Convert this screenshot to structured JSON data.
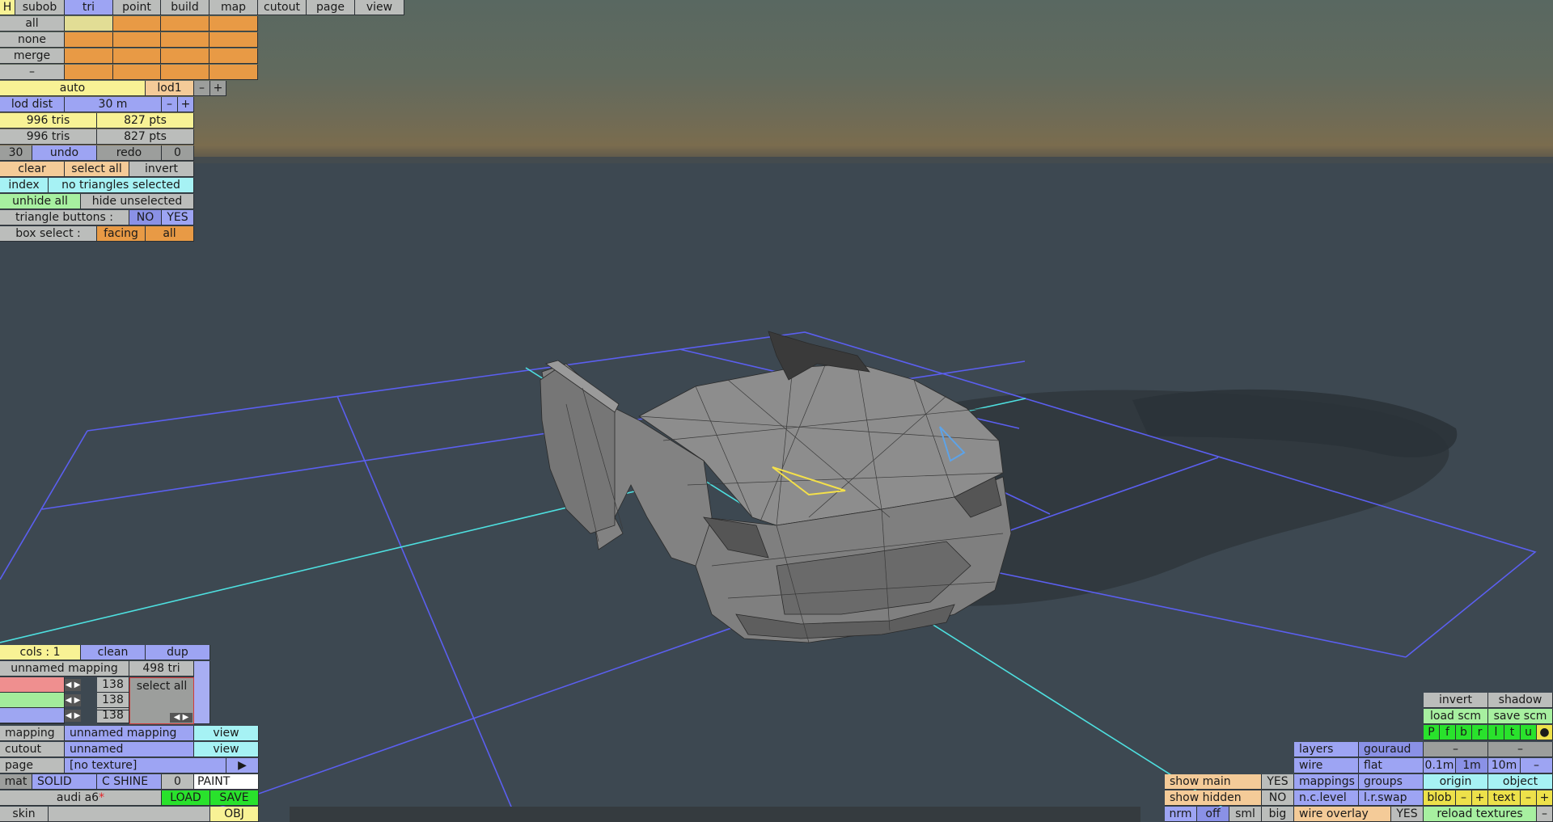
{
  "menu": {
    "h": "H",
    "tabs": [
      "subob",
      "tri",
      "point",
      "build",
      "map",
      "cutout",
      "page",
      "view"
    ],
    "active_tab": "tri"
  },
  "subob_rows": [
    "all",
    "none",
    "merge",
    "–"
  ],
  "lod": {
    "mode": "auto",
    "level": "lod1",
    "minus": "–",
    "plus": "+",
    "dist_label": "lod dist",
    "dist_value": "30 m"
  },
  "stats": {
    "row1_tris": "996 tris",
    "row1_pts": "827 pts",
    "row2_tris": "996 tris",
    "row2_pts": "827 pts"
  },
  "history": {
    "count": "30",
    "undo": "undo",
    "redo": "redo",
    "redo_count": "0"
  },
  "selection": {
    "clear": "clear",
    "select_all": "select all",
    "invert": "invert",
    "index": "index",
    "status": "no triangles selected",
    "unhide_all": "unhide all",
    "hide_unselected": "hide unselected",
    "triangle_buttons_label": "triangle buttons :",
    "no": "NO",
    "yes": "YES",
    "box_select_label": "box select :",
    "facing": "facing",
    "all": "all"
  },
  "mapping_panel": {
    "cols": "cols : 1",
    "clean": "clean",
    "dup": "dup",
    "mapping_name": "unnamed mapping",
    "tri_count": "498 tri",
    "channels": [
      {
        "color": "#ef8f8f",
        "value": "138"
      },
      {
        "color": "#a3ec9b",
        "value": "138"
      },
      {
        "color": "#9ea6f2",
        "value": "138"
      },
      {
        "color": "#bbbdbb",
        "value": "138"
      }
    ],
    "select_all": "select all",
    "mapping_label": "mapping",
    "mapping_value": "unnamed mapping",
    "view1": "view",
    "cutout_label": "cutout",
    "cutout_value": "unnamed",
    "view2": "view",
    "page_label": "page",
    "page_value": "[no texture]",
    "page_arrow": "▶",
    "mat": "mat",
    "solid": "SOLID",
    "c_shine": "C SHINE",
    "zero": "0",
    "paint": "PAINT",
    "model_name": "audi a6",
    "modified_mark": "*",
    "load": "LOAD",
    "save": "SAVE",
    "skin": "skin",
    "obj": "OBJ"
  },
  "view_panel": {
    "invert": "invert",
    "shadow": "shadow",
    "load_scm": "load scm",
    "save_scm": "save scm",
    "flags": [
      "P",
      "f",
      "b",
      "r",
      "l",
      "t",
      "u",
      "●"
    ],
    "layers": "layers",
    "gouraud": "gouraud",
    "dash1": "–",
    "dash2": "–",
    "wire": "wire",
    "flat": "flat",
    "grid_01": "0.1m",
    "grid_1": "1m",
    "grid_10": "10m",
    "grid_minus": "–",
    "show_main": "show main",
    "show_main_val": "YES",
    "mappings": "mappings",
    "groups": "groups",
    "origin": "origin",
    "object": "object",
    "show_hidden": "show hidden",
    "show_hidden_val": "NO",
    "nc_level": "n.c.level",
    "lr_swap": "l.r.swap",
    "blob": "blob",
    "blob_minus": "–",
    "blob_plus": "+",
    "text": "text",
    "text_minus": "–",
    "text_plus": "+",
    "nrm": "nrm",
    "off": "off",
    "sml": "sml",
    "big": "big",
    "wire_overlay": "wire overlay",
    "wire_overlay_val": "YES",
    "reload_textures": "reload textures",
    "reload_minus": "–"
  }
}
